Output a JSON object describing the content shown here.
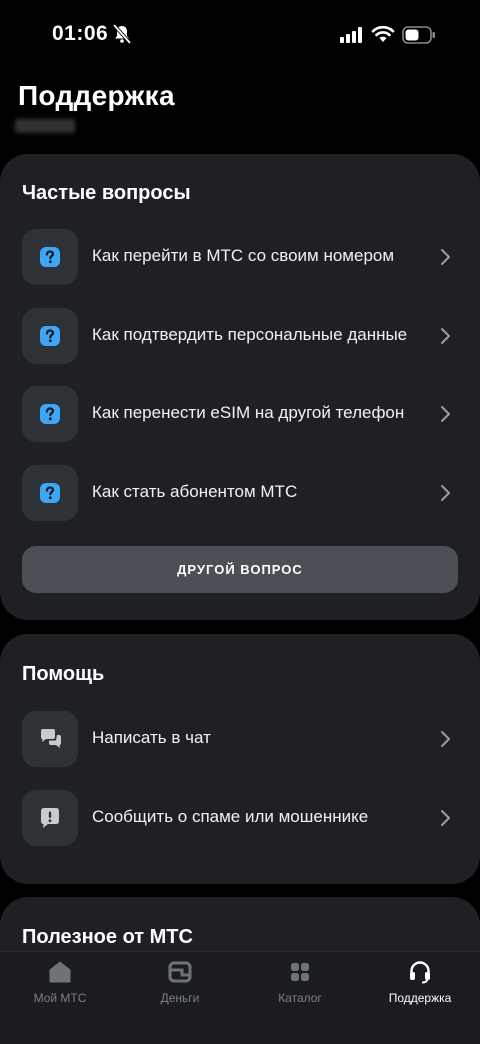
{
  "status_bar": {
    "time": "01:06"
  },
  "page": {
    "title": "Поддержка"
  },
  "faq": {
    "title": "Частые вопросы",
    "items": [
      {
        "label": "Как перейти в МТС со своим номером",
        "icon": "question-icon"
      },
      {
        "label": "Как подтвердить персональные данные",
        "icon": "question-icon"
      },
      {
        "label": "Как перенести eSIM на другой телефон",
        "icon": "question-icon"
      },
      {
        "label": "Как стать абонентом МТС",
        "icon": "question-icon"
      }
    ],
    "other_button": "ДРУГОЙ ВОПРОС"
  },
  "help": {
    "title": "Помощь",
    "items": [
      {
        "label": "Написать в чат",
        "icon": "chat-icon"
      },
      {
        "label": "Сообщить о спаме или мошеннике",
        "icon": "alert-message-icon"
      }
    ]
  },
  "useful": {
    "title": "Полезное от МТС"
  },
  "tabbar": {
    "items": [
      {
        "label": "Мой МТС",
        "icon": "home-icon",
        "active": false
      },
      {
        "label": "Деньги",
        "icon": "wallet-icon",
        "active": false
      },
      {
        "label": "Каталог",
        "icon": "catalog-grid-icon",
        "active": false
      },
      {
        "label": "Поддержка",
        "icon": "headset-icon",
        "active": true
      }
    ]
  },
  "colors": {
    "background": "#000000",
    "card": "#1e2024",
    "icon_accent": "#3ea6f5",
    "button": "#4b5056"
  }
}
